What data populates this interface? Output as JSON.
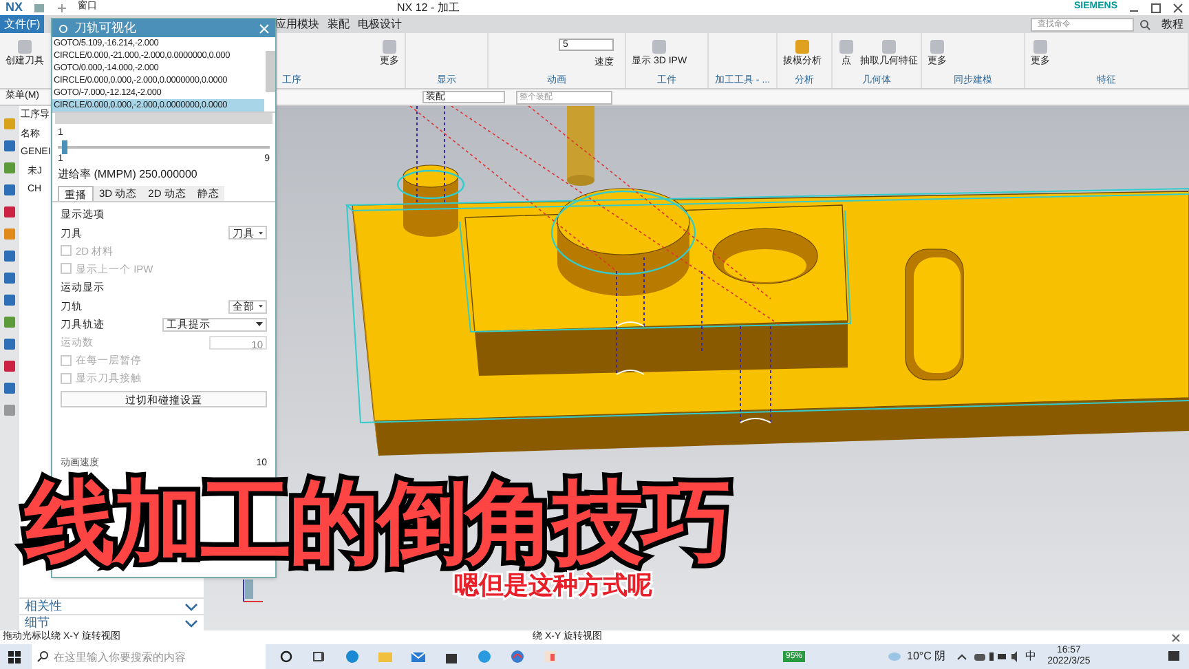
{
  "title_bar": {
    "logo": "NX",
    "window_menu": "窗口",
    "title": "NX 12 - 加工",
    "brand": "SIEMENS"
  },
  "menu_bar": {
    "items": [
      {
        "label": "文件(F)",
        "selected": true
      },
      {
        "label": "应用模块",
        "selected": false
      },
      {
        "label": "装配",
        "selected": false
      },
      {
        "label": "电极设计",
        "selected": false
      }
    ],
    "search": {
      "placeholder": "查找命令"
    },
    "help": "教程"
  },
  "ribbon": {
    "groups": [
      {
        "name": "工序",
        "buttons": [
          "创建刀具",
          "更多"
        ]
      },
      {
        "name": "显示"
      },
      {
        "name": "动画",
        "speed": "5",
        "speed_label": "速度"
      },
      {
        "name": "工件",
        "buttons": [
          "显示 3D IPW"
        ]
      },
      {
        "name": "加工工具 - ..."
      },
      {
        "name": "分析",
        "buttons": [
          "拔模分析"
        ]
      },
      {
        "name": "几何体",
        "buttons": [
          "点",
          "抽取几何特征"
        ]
      },
      {
        "name": "同步建模",
        "buttons": [
          "更多"
        ]
      },
      {
        "name": "特征",
        "buttons": [
          "更多"
        ]
      }
    ]
  },
  "toolbar": {
    "menu": "菜单(M)",
    "filter": "装配",
    "scope_placeholder": "整个装配"
  },
  "navigator": {
    "header": "工序导",
    "column": "名称",
    "tree": [
      {
        "label": "GENEI",
        "children": [
          {
            "label": "未J"
          },
          {
            "label": "CH"
          }
        ]
      }
    ]
  },
  "dialog": {
    "title": "刀轨可视化",
    "lines": [
      {
        "text": "GOTO/5.109,-16.214,-2.000",
        "selected": false
      },
      {
        "text": "CIRCLE/0.000,-21.000,-2.000,0.0000000,0.000",
        "selected": false
      },
      {
        "text": "GOTO/0.000,-14.000,-2.000",
        "selected": false
      },
      {
        "text": "CIRCLE/0.000,0.000,-2.000,0.0000000,0.0000",
        "selected": false
      },
      {
        "text": "GOTO/-7.000,-12.124,-2.000",
        "selected": false
      },
      {
        "text": "CIRCLE/0.000,0.000,-2.000,0.0000000,0.0000",
        "selected": true
      }
    ],
    "slider": {
      "value": "1",
      "min": "1",
      "max": "9",
      "level": 0.02
    },
    "feed_rate": "进给率 (MMPM) 250.000000",
    "tabs": [
      {
        "label": "重播",
        "selected": true
      },
      {
        "label": "3D 动态",
        "selected": false
      },
      {
        "label": "2D 动态",
        "selected": false
      },
      {
        "label": "静态",
        "selected": false
      }
    ],
    "sections": [
      {
        "title": "显示选项",
        "rows": [
          {
            "kind": "dropdown",
            "label": "刀具",
            "value": "刀具",
            "disabled": false
          },
          {
            "kind": "checkbox",
            "label": "2D 材料",
            "checked": false,
            "disabled": true
          },
          {
            "kind": "checkbox",
            "label": "显示上一个 IPW",
            "checked": false,
            "disabled": true
          }
        ]
      },
      {
        "title": "运动显示",
        "rows": [
          {
            "kind": "dropdown",
            "label": "刀轨",
            "value": "全部",
            "disabled": false
          },
          {
            "kind": "dropdown",
            "label": "刀具轨迹",
            "value": "工具提示",
            "disabled": false
          },
          {
            "kind": "number",
            "label": "运动数",
            "value": "10",
            "disabled": true
          },
          {
            "kind": "checkbox",
            "label": "在每一层暂停",
            "checked": false,
            "disabled": true
          },
          {
            "kind": "checkbox",
            "label": "显示刀具接触",
            "checked": false,
            "disabled": true
          }
        ]
      }
    ],
    "settings_button": "过切和碰撞设置",
    "speed_label": "动画速度",
    "speed_max": "10"
  },
  "panels": [
    {
      "label": "相关性",
      "expanded": false
    },
    {
      "label": "细节",
      "expanded": false
    }
  ],
  "status_bar": {
    "left": "拖动光标以绕 X-Y 旋转视图",
    "right": "绕 X-Y 旋转视图"
  },
  "taskbar": {
    "search_placeholder": "在这里输入你要搜索的内容",
    "battery": "95%",
    "weather": "10°C 阴",
    "ime": "中",
    "time": "16:57",
    "date": "2022/3/25"
  },
  "overlay": {
    "title": "线加工的倒角技巧",
    "subtitle": "嗯但是这种方式呢"
  }
}
